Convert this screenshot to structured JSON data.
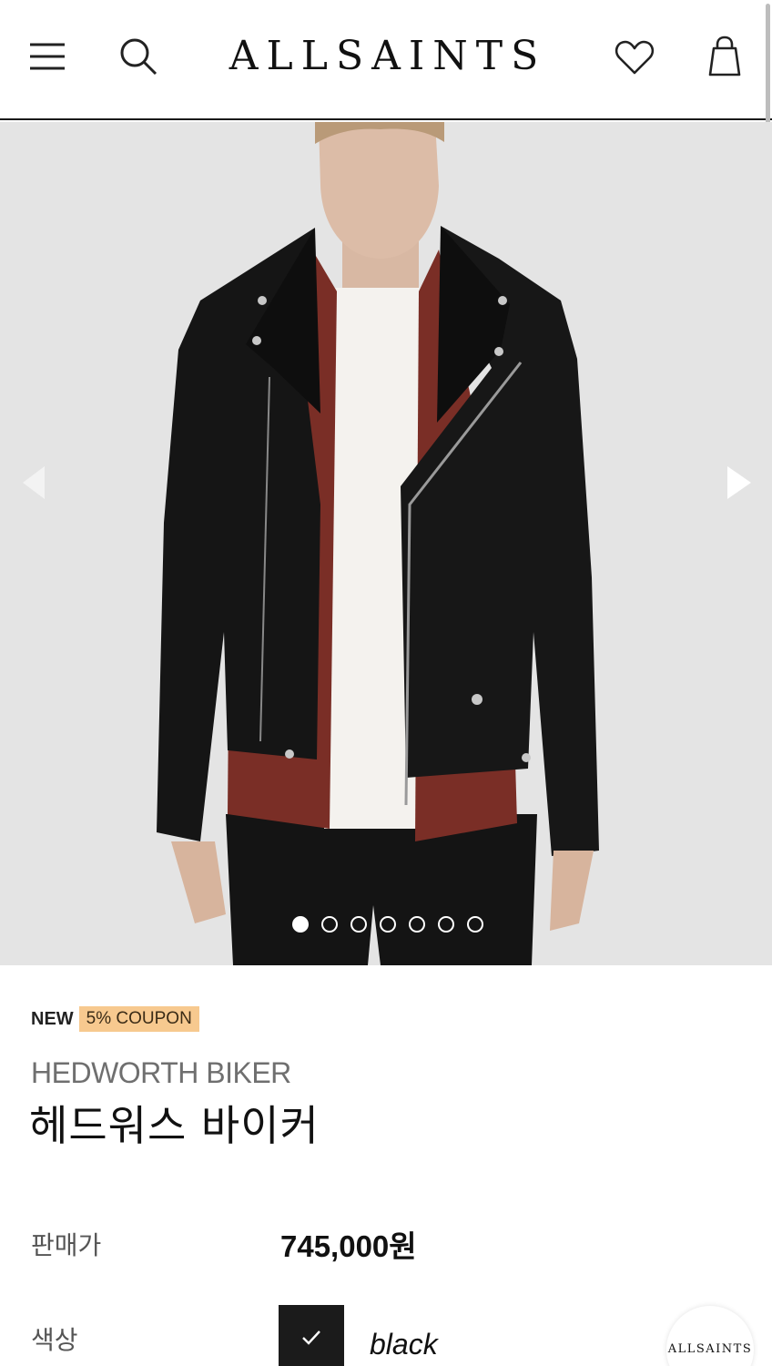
{
  "header": {
    "logo": "ALLSAINTS",
    "icons": {
      "menu": "hamburger-menu-icon",
      "search": "search-icon",
      "wishlist": "heart-icon",
      "bag": "shopping-bag-icon"
    }
  },
  "gallery": {
    "image_alt": "HEDWORTH BIKER",
    "total_images": 7,
    "active_index": 0,
    "prev_icon": "chevron-left-icon",
    "next_icon": "chevron-right-icon"
  },
  "product": {
    "badge_new": "NEW",
    "badge_coupon": "5% COUPON",
    "name_en": "HEDWORTH BIKER",
    "name_ko": "헤드워스 바이커",
    "price_label": "판매가",
    "price": "745,000원",
    "color_label": "색상",
    "selected_color": "black",
    "selected_color_hex": "#1b1b1b"
  },
  "floating_button": {
    "label": "ALLSAINTS"
  },
  "colors": {
    "coupon_bg": "#f7c98f",
    "photo_bg": "#e3e3e3",
    "jacket": "#151515",
    "shirt": "#7a2e26"
  }
}
